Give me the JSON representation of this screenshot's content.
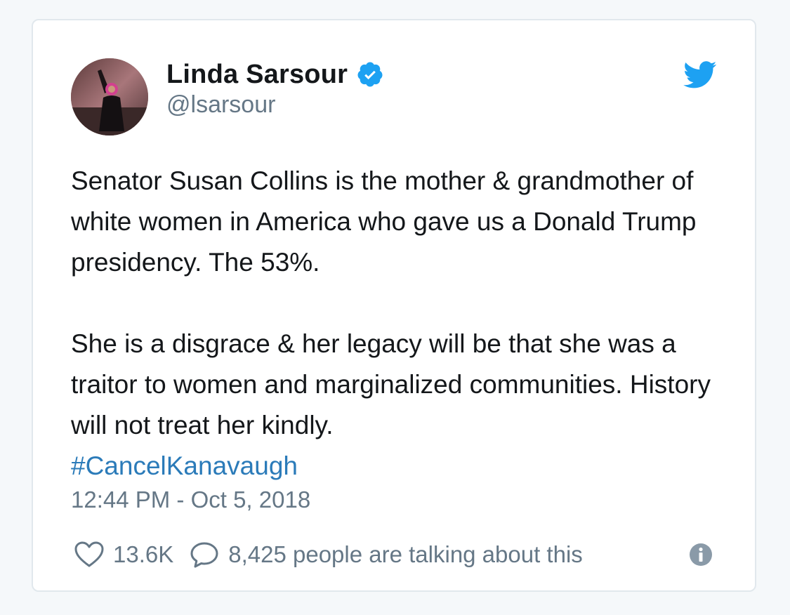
{
  "tweet": {
    "author": {
      "display_name": "Linda Sarsour",
      "handle": "@lsarsour",
      "verified": true,
      "avatar_icon": "profile-photo"
    },
    "paragraphs": [
      "Senator Susan Collins is the mother & grandmother of white women in America who gave us a Donald Trump presidency. The 53%.",
      "She is a disgrace & her legacy will be that she was a traitor to women and marginalized communities. History will not treat her kindly."
    ],
    "hashtag": "#CancelKanavaugh",
    "timestamp": "12:44 PM - Oct 5, 2018",
    "actions": {
      "like_count": "13.6K",
      "talking_label": "8,425 people are talking about this"
    },
    "icons": {
      "brand": "twitter-bird-icon",
      "verified": "verified-badge-icon",
      "like": "heart-icon",
      "reply": "speech-bubble-icon",
      "info": "info-icon"
    },
    "colors": {
      "brand": "#1da1f2",
      "link": "#2b7bb9",
      "secondary_text": "#657786",
      "primary_text": "#14171a",
      "border": "#e1e8ed"
    }
  }
}
